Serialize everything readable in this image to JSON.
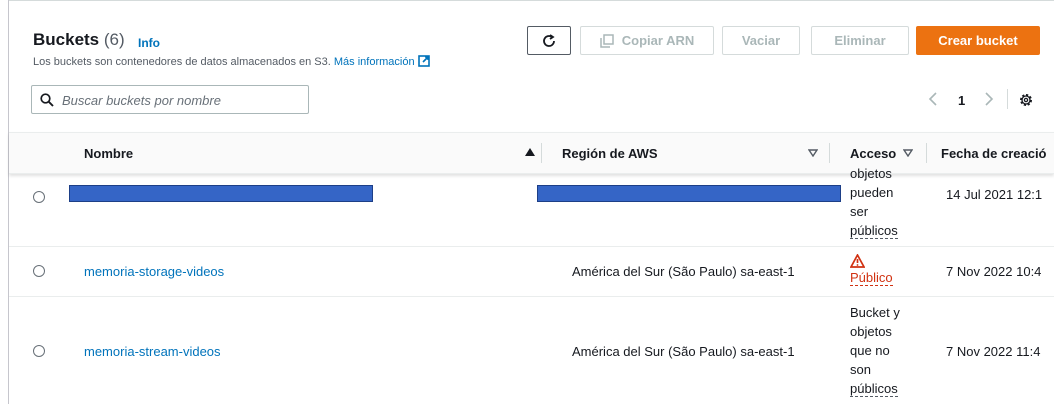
{
  "header": {
    "title": "Buckets",
    "count": "(6)",
    "info": "Info",
    "description": "Los buckets son contenedores de datos almacenados en S3.",
    "more_info": "Más información"
  },
  "toolbar": {
    "refresh": "refresh-icon",
    "copy_arn": "Copiar ARN",
    "empty": "Vaciar",
    "delete": "Eliminar",
    "create": "Crear bucket"
  },
  "search": {
    "placeholder": "Buscar buckets por nombre"
  },
  "pagination": {
    "prev": "‹",
    "page": "1",
    "next": "›"
  },
  "table": {
    "columns": {
      "name": "Nombre",
      "region": "Región de AWS",
      "access": "Acceso",
      "date": "Fecha de creació"
    },
    "rows": [
      {
        "name": "",
        "region": "",
        "access_lines": [
          "objetos",
          "pueden",
          "ser",
          "públicos"
        ],
        "date": "14 Jul 2021 12:1"
      },
      {
        "name": "memoria-storage-videos",
        "region": "América del Sur (São Paulo) sa-east-1",
        "access_lines": [
          "Público"
        ],
        "date": "7 Nov 2022 10:4"
      },
      {
        "name": "memoria-stream-videos",
        "region": "América del Sur (São Paulo) sa-east-1",
        "access_lines": [
          "Bucket y",
          "objetos",
          "que no",
          "son",
          "públicos"
        ],
        "date": "7 Nov 2022 11:4"
      }
    ]
  },
  "colors": {
    "accent": "#ec7211",
    "link": "#0073bb",
    "warning": "#d13212",
    "redaction": "#3565c6"
  }
}
